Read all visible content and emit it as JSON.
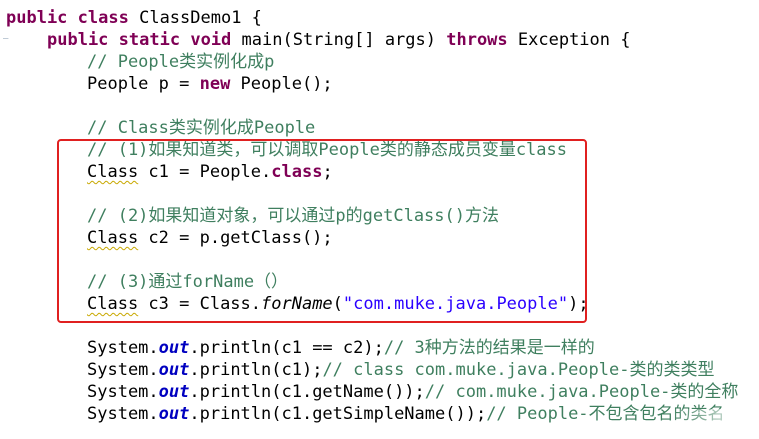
{
  "code": {
    "l1": {
      "kw1": "public",
      "kw2": "class",
      "rest": " ClassDemo1 {"
    },
    "l2": {
      "kw1": "public",
      "kw2": "static",
      "kw3": "void",
      "mid": " main(String[] args) ",
      "kw4": "throws",
      "rest": " Exception {"
    },
    "l3": {
      "comment": "// People类实例化成p"
    },
    "l4": {
      "a": "People p = ",
      "kw": "new",
      "b": " People();"
    },
    "l6": {
      "comment": "// Class类实例化成People"
    },
    "l7": {
      "comment": "// (1)如果知道类，可以调取People类的静态成员变量class"
    },
    "l8": {
      "cls": "Class",
      "a": " c1 = People.",
      "kw": "class",
      "b": ";"
    },
    "l10": {
      "comment": "// (2)如果知道对象，可以通过p的getClass()方法"
    },
    "l11": {
      "cls": "Class",
      "a": " c2 = p.getClass();"
    },
    "l13": {
      "comment": "// (3)通过forName（）"
    },
    "l14": {
      "cls": "Class",
      "a": " c3 = Class.",
      "method": "forName",
      "b": "(",
      "str": "\"com.muke.java.People\"",
      "c": ");"
    },
    "l16": {
      "a": "System.",
      "fld": "out",
      "b": ".println(c1 == c2);",
      "comment": "// 3种方法的结果是一样的"
    },
    "l17": {
      "a": "System.",
      "fld": "out",
      "b": ".println(c1);",
      "comment": "// class com.muke.java.People-类的类类型"
    },
    "l18": {
      "a": "System.",
      "fld": "out",
      "b": ".println(c1.getName());",
      "comment": "// com.muke.java.People-类的全称"
    },
    "l19": {
      "a": "System.",
      "fld": "out",
      "b": ".println(c1.getSimpleName());",
      "comment": "// People-不包含包名的类名"
    }
  },
  "colors": {
    "keyword": "#7f0055",
    "comment": "#3f7f5f",
    "string": "#2a00ff",
    "field": "#0000c0",
    "highlight_border": "#e02020"
  },
  "icons": {
    "gutter": "collapse-marker-icon"
  }
}
